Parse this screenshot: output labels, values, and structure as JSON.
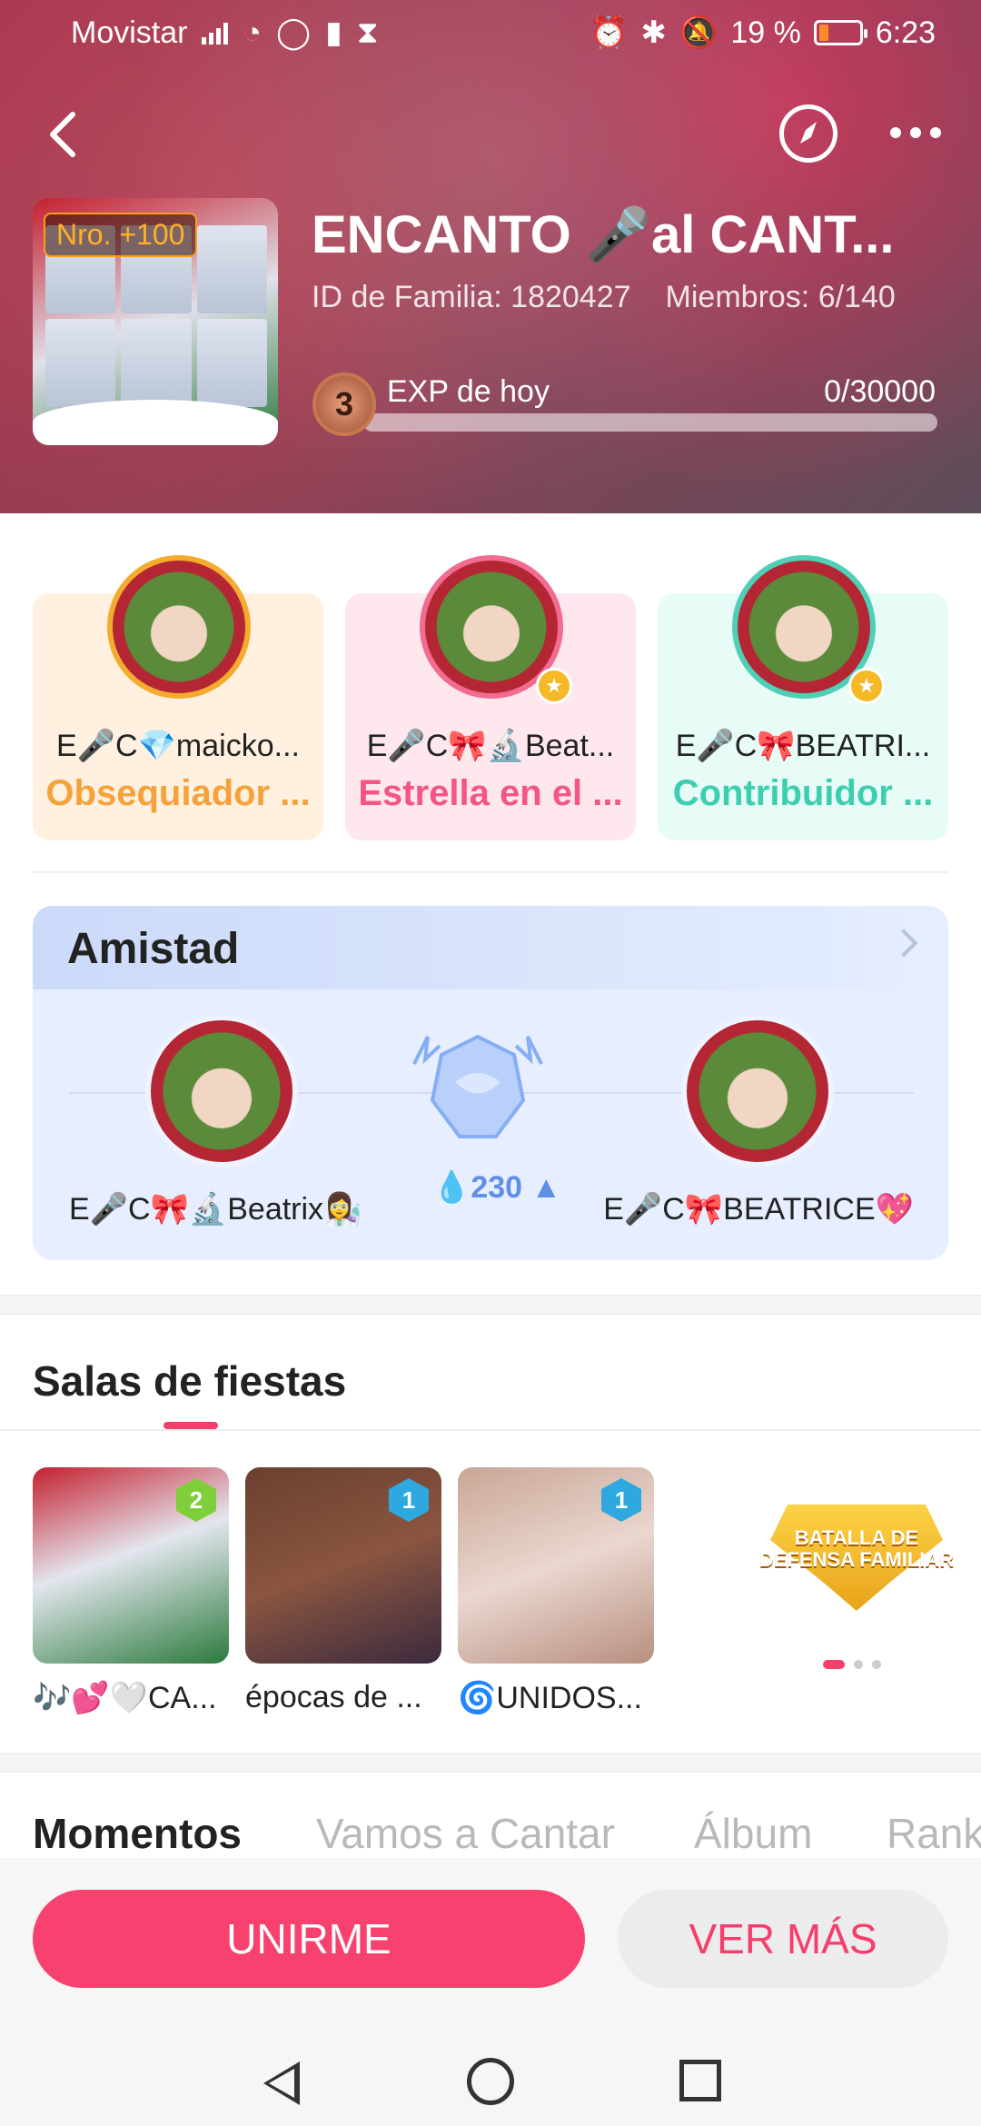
{
  "status": {
    "carrier": "Movistar",
    "battery": "19 %",
    "time": "6:23"
  },
  "family": {
    "name": "ENCANTO 🎤al  CANT...",
    "id_text": "ID de Familia: 1820427",
    "members_text": "Miembros: 6/140",
    "rank_badge": "Nro. +100",
    "level": "3",
    "exp_label": "EXP de hoy",
    "exp_value": "0/30000",
    "exp_progress": 0
  },
  "top_members": [
    {
      "name": "E🎤C💎maicko...",
      "role": "Obsequiador ..."
    },
    {
      "name": "E🎤C🎀🔬Beat...",
      "role": "Estrella en el ..."
    },
    {
      "name": "E🎤C🎀BEATRI...",
      "role": "Contribuidor ..."
    }
  ],
  "friendship": {
    "title": "Amistad",
    "left_name": "E🎤C🎀🔬Beatrix👩‍🔬",
    "right_name": "E🎤C🎀BEATRICE💖",
    "score": "💧230 ▲"
  },
  "party_rooms": {
    "title": "Salas de fiestas",
    "rooms": [
      {
        "label": "🎶💕🤍CA...",
        "level": "2"
      },
      {
        "label": "épocas de ...",
        "level": "1"
      },
      {
        "label": "🌀UNIDOS...",
        "level": "1"
      }
    ],
    "banner_text": "BATALLA DE DEFENSA FAMILIAR"
  },
  "tabs": [
    "Momentos",
    "Vamos a Cantar",
    "Álbum",
    "Rank"
  ],
  "actions": {
    "join": "UNIRME",
    "more": "VER MÁS"
  }
}
